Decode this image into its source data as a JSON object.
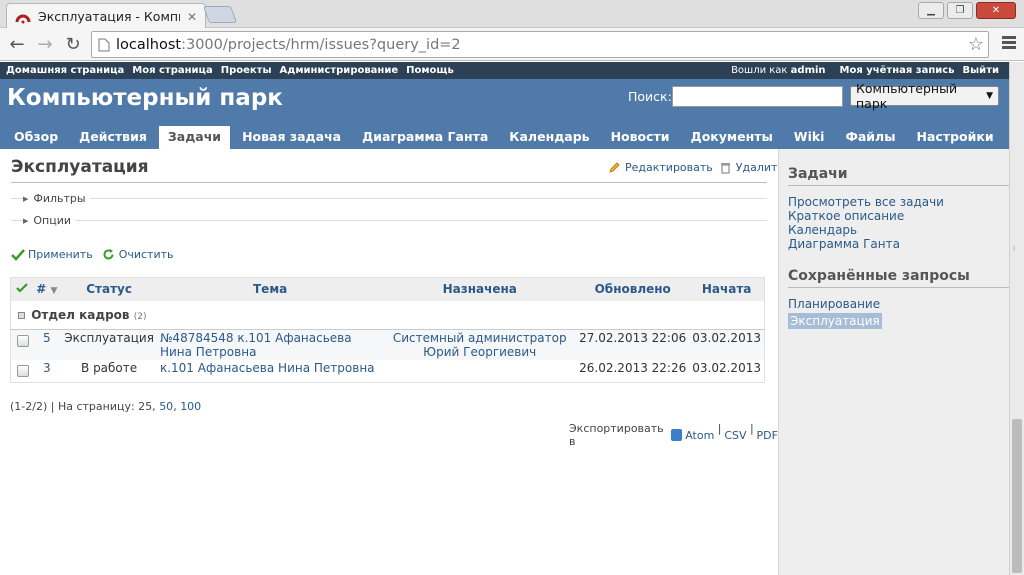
{
  "browser": {
    "tab_title": "Эксплуатация - Компьютер",
    "url_host": "localhost",
    "url_path": ":3000/projects/hrm/issues?query_id=2"
  },
  "top_menu": {
    "items": [
      "Домашняя страница",
      "Моя страница",
      "Проекты",
      "Администрирование",
      "Помощь"
    ],
    "logged_as_prefix": "Вошли как",
    "logged_as_user": "admin",
    "my_account": "Моя учётная запись",
    "logout": "Выйти"
  },
  "header": {
    "project_title": "Компьютерный парк",
    "search_label": "Поиск:",
    "search_value": "",
    "project_select": "Компьютерный парк"
  },
  "main_menu": {
    "items": [
      "Обзор",
      "Действия",
      "Задачи",
      "Новая задача",
      "Диаграмма Ганта",
      "Календарь",
      "Новости",
      "Документы",
      "Wiki",
      "Файлы",
      "Настройки"
    ],
    "selected": "Задачи"
  },
  "content": {
    "title": "Эксплуатация",
    "edit_label": "Редактировать",
    "delete_label": "Удалить",
    "filters_label": "Фильтры",
    "options_label": "Опции",
    "apply_label": "Применить",
    "clear_label": "Очистить",
    "columns": {
      "num": "#",
      "status": "Статус",
      "subject": "Тема",
      "assigned": "Назначена",
      "updated": "Обновлено",
      "start": "Начата"
    },
    "group": {
      "name": "Отдел кадров",
      "count": "(2)"
    },
    "rows": [
      {
        "id": "5",
        "status": "Эксплуатация",
        "subject": "№48784548 к.101 Афанасьева Нина Петровна",
        "assigned": "Системный администратор Юрий Георгиевич",
        "updated": "27.02.2013 22:06",
        "start": "03.02.2013"
      },
      {
        "id": "3",
        "status": "В работе",
        "subject": "к.101 Афанасьева Нина Петровна",
        "assigned": "",
        "updated": "26.02.2013 22:26",
        "start": "03.02.2013"
      }
    ],
    "pagination": {
      "summary": "(1-2/2) | На страницу: 25,",
      "opt50": "50",
      "opt100": "100"
    },
    "export": {
      "prefix": "Экспортировать в",
      "atom": "Atom",
      "csv": "CSV",
      "pdf": "PDF"
    }
  },
  "sidebar": {
    "issues_heading": "Задачи",
    "issues_links": [
      "Просмотреть все задачи",
      "Краткое описание",
      "Календарь",
      "Диаграмма Ганта"
    ],
    "queries_heading": "Сохранённые запросы",
    "queries": [
      "Планирование",
      "Эксплуатация"
    ]
  }
}
